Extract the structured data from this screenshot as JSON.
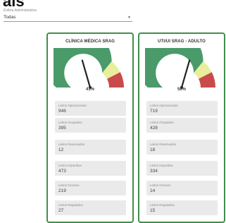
{
  "page": {
    "heading_fragment": "ais"
  },
  "filter": {
    "label": "Esfera Administrativa",
    "value": "Todas"
  },
  "colors": {
    "green": "#4a9a6a",
    "yellow": "#e8ee9a",
    "red": "#c94a4a",
    "border": "#3f8f4c"
  },
  "cards": [
    {
      "title": "CLÍNICA MÉDICA SRAG",
      "gauge_percent": 41,
      "gauge_label": "41%",
      "stats": [
        {
          "label": "Leitos Operacionais",
          "value": "946"
        },
        {
          "label": "Leitos Ocupados",
          "value": "395"
        },
        {
          "label": "Leitos Reservados",
          "value": "12"
        },
        {
          "label": "Leitos Impeditos",
          "value": "473"
        },
        {
          "label": "Leitos Ociosos",
          "value": "219"
        },
        {
          "label": "Leitos Regulados",
          "value": "27"
        }
      ]
    },
    {
      "title": "UTI/UI SRAG - ADULTO",
      "gauge_percent": 59,
      "gauge_label": "59%",
      "stats": [
        {
          "label": "Leitos Operacionais",
          "value": "719"
        },
        {
          "label": "Leitos Ocupados",
          "value": "428"
        },
        {
          "label": "Leitos Reservados",
          "value": "18"
        },
        {
          "label": "Leitos Impeditos",
          "value": "334"
        },
        {
          "label": "Leitos Ociosos",
          "value": "14"
        },
        {
          "label": "Leitos Regulados",
          "value": "15"
        }
      ]
    }
  ]
}
